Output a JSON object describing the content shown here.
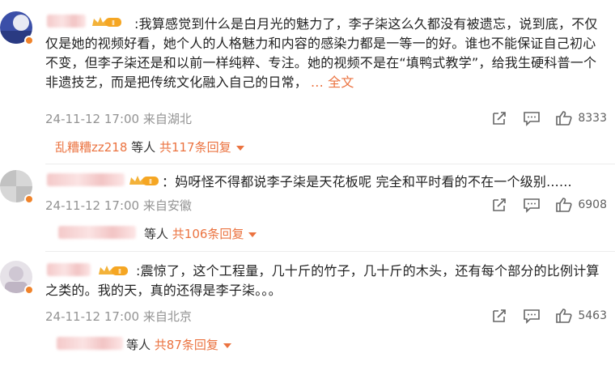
{
  "comments": [
    {
      "text": ":我算感觉到什么是白月光的魅力了，李子柒这么久都没有被遗忘，说到底，不仅仅是她的视频好看，她个人的人格魅力和内容的感染力都是一等一的好。谁也不能保证自己初心不变，但李子柒还是和以前一样纯粹、专注。她的视频不是在“填鸭式教学”，给我生硬科普一个非遗技艺，而是把传统文化融入自己的日常，",
      "more": "... 全文",
      "time": "24-11-12 17:00 来自湖北",
      "likes": "8333",
      "reply_user": "乱糟糟zz218",
      "reply_suffix": " 等人 ",
      "reply_total": "共117条回复"
    },
    {
      "text": "：妈呀怪不得都说李子柒是天花板呢 完全和平时看的不在一个级别......",
      "time": "24-11-12 17:00 来自安徽",
      "likes": "6908",
      "reply_suffix": "等人 ",
      "reply_total": "共106条回复"
    },
    {
      "text": ":震惊了，这个工程量，几十斤的竹子，几十斤的木头，还有每个部分的比例计算之类的。我的天，真的还得是李子柒。。。",
      "time": "24-11-12 17:00 来自北京",
      "likes": "5463",
      "reply_suffix": "等人 ",
      "reply_total": "共87条回复"
    }
  ],
  "icons": {
    "share": "share-icon",
    "comment": "comment-icon",
    "like": "thumbs-up-icon",
    "vip": "vip-crown-badge-icon"
  },
  "colors": {
    "accent": "#eb7340",
    "meta": "#939393",
    "badge": "#f0832a"
  }
}
